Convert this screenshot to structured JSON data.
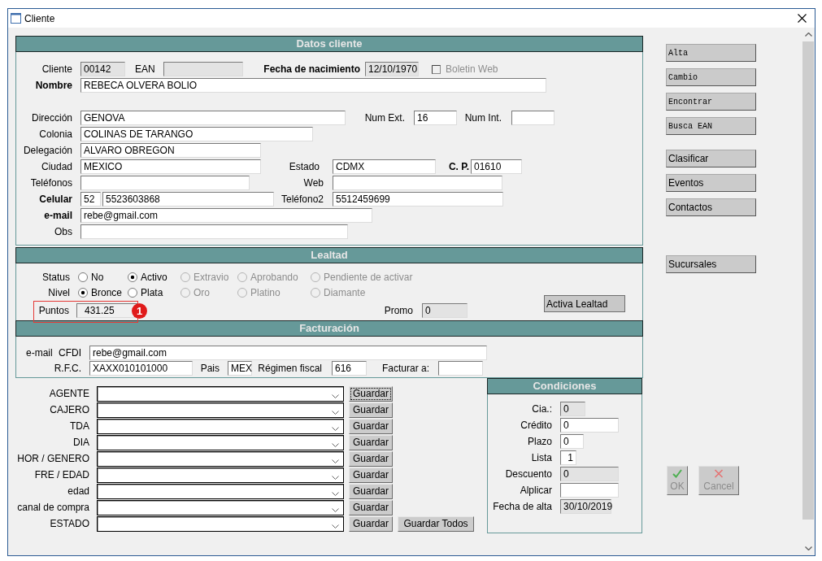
{
  "window": {
    "title": "Cliente"
  },
  "datos_cliente": {
    "title": "Datos cliente",
    "cliente": {
      "label": "Cliente",
      "value": "00142",
      "readonly": true
    },
    "ean": {
      "label": "EAN",
      "readonly": true
    },
    "fecha_nacimiento": {
      "label": "Fecha de nacimiento",
      "value": "12/10/1970",
      "readonly": true
    },
    "boletin_web": {
      "label": "Boletin Web",
      "checked": false,
      "disabled": true
    },
    "nombre": {
      "label": "Nombre",
      "value": "REBECA OLVERA BOLIO"
    },
    "direccion": {
      "label": "Dirección",
      "value": "GENOVA"
    },
    "num_ext": {
      "label": "Num Ext.",
      "value": "16"
    },
    "num_int": {
      "label": "Num Int."
    },
    "colonia": {
      "label": "Colonia",
      "value": "COLINAS DE TARANGO"
    },
    "delegacion": {
      "label": "Delegación",
      "value": "ALVARO OBREGON"
    },
    "ciudad": {
      "label": "Ciudad",
      "value": "MEXICO"
    },
    "estado": {
      "label": "Estado",
      "value": "CDMX"
    },
    "cp": {
      "label": "C. P.",
      "value": "01610"
    },
    "telefonos": {
      "label": "Teléfonos"
    },
    "web": {
      "label": "Web"
    },
    "celular": {
      "label": "Celular",
      "lada": "52",
      "value": "5523603868"
    },
    "telefono2": {
      "label": "Teléfono2",
      "value": "5512459699"
    },
    "email": {
      "label": "e-mail",
      "value": "rebe@gmail.com"
    },
    "obs": {
      "label": "Obs"
    }
  },
  "lealtad": {
    "title": "Lealtad",
    "status": {
      "label": "Status",
      "options": [
        {
          "label": "No",
          "selected": false,
          "disabled": false
        },
        {
          "label": "Activo",
          "selected": true,
          "disabled": false
        },
        {
          "label": "Extravio",
          "selected": false,
          "disabled": true
        },
        {
          "label": "Aprobando",
          "selected": false,
          "disabled": true
        },
        {
          "label": "Pendiente de activar",
          "selected": false,
          "disabled": true
        }
      ]
    },
    "nivel": {
      "label": "Nivel",
      "options": [
        {
          "label": "Bronce",
          "selected": true,
          "disabled": false
        },
        {
          "label": "Plata",
          "selected": false,
          "disabled": false
        },
        {
          "label": "Oro",
          "selected": false,
          "disabled": true
        },
        {
          "label": "Platino",
          "selected": false,
          "disabled": true
        },
        {
          "label": "Diamante",
          "selected": false,
          "disabled": true
        }
      ]
    },
    "puntos": {
      "label": "Puntos",
      "value": "431.25",
      "disabled": true,
      "callout": "1"
    },
    "promo": {
      "label": "Promo",
      "value": "0",
      "readonly": true
    },
    "activa_button": {
      "label": "Activa Lealtad"
    }
  },
  "facturacion": {
    "title": "Facturación",
    "email_cfdi": {
      "label": "e-mail CFDI",
      "value": "rebe@gmail.com"
    },
    "rfc": {
      "label": "R.F.C.",
      "value": "XAXX010101000"
    },
    "pais": {
      "label": "Pais",
      "value": "MEX"
    },
    "regimen_fiscal": {
      "label": "Régimen fiscal",
      "value": "616"
    },
    "facturar_a": {
      "label": "Facturar a:"
    }
  },
  "clasificacion": {
    "rows": [
      {
        "label": "AGENTE",
        "button": "Guardar",
        "focused": true
      },
      {
        "label": "CAJERO",
        "button": "Guardar",
        "focused": false
      },
      {
        "label": "TDA",
        "button": "Guardar",
        "focused": false
      },
      {
        "label": "DIA",
        "button": "Guardar",
        "focused": false
      },
      {
        "label": "HOR / GENERO",
        "button": "Guardar",
        "focused": false
      },
      {
        "label": "FRE / EDAD",
        "button": "Guardar",
        "focused": false
      },
      {
        "label": "edad",
        "button": "Guardar",
        "focused": false
      },
      {
        "label": "canal de compra",
        "button": "Guardar",
        "focused": false
      },
      {
        "label": "ESTADO",
        "button": "Guardar",
        "focused": false
      }
    ],
    "save_all_button": "Guardar Todos"
  },
  "condiciones": {
    "title": "Condiciones",
    "fields": [
      {
        "label": "Cia.:",
        "value": "0",
        "readonly": true
      },
      {
        "label": "Crédito",
        "value": "0",
        "readonly": false
      },
      {
        "label": "Plazo",
        "value": "0",
        "readonly": false
      },
      {
        "label": "Lista",
        "value": "1",
        "readonly": false
      },
      {
        "label": "Descuento",
        "value": "0",
        "readonly": true
      },
      {
        "label": "Alplicar",
        "readonly": false
      },
      {
        "label": "Fecha de alta",
        "value": "30/10/2019",
        "readonly": true
      }
    ]
  },
  "side_button_groups": [
    {
      "buttons": [
        {
          "label": "Alta",
          "kind": "terminal"
        },
        {
          "label": "Cambio",
          "kind": "terminal"
        },
        {
          "label": "Encontrar",
          "kind": "terminal"
        },
        {
          "label": "Busca EAN",
          "kind": "terminal"
        }
      ]
    },
    {
      "buttons": [
        {
          "label": "Clasificar",
          "kind": "standard"
        },
        {
          "label": "Eventos",
          "kind": "standard"
        },
        {
          "label": "Contactos",
          "kind": "standard"
        }
      ]
    },
    {
      "buttons": [
        {
          "label": "Sucursales",
          "kind": "standard"
        }
      ]
    }
  ],
  "dialog_buttons": [
    {
      "label": "OK",
      "kind": "ok",
      "disabled": true
    },
    {
      "label": "Cancel",
      "kind": "cancel",
      "disabled": true
    }
  ]
}
